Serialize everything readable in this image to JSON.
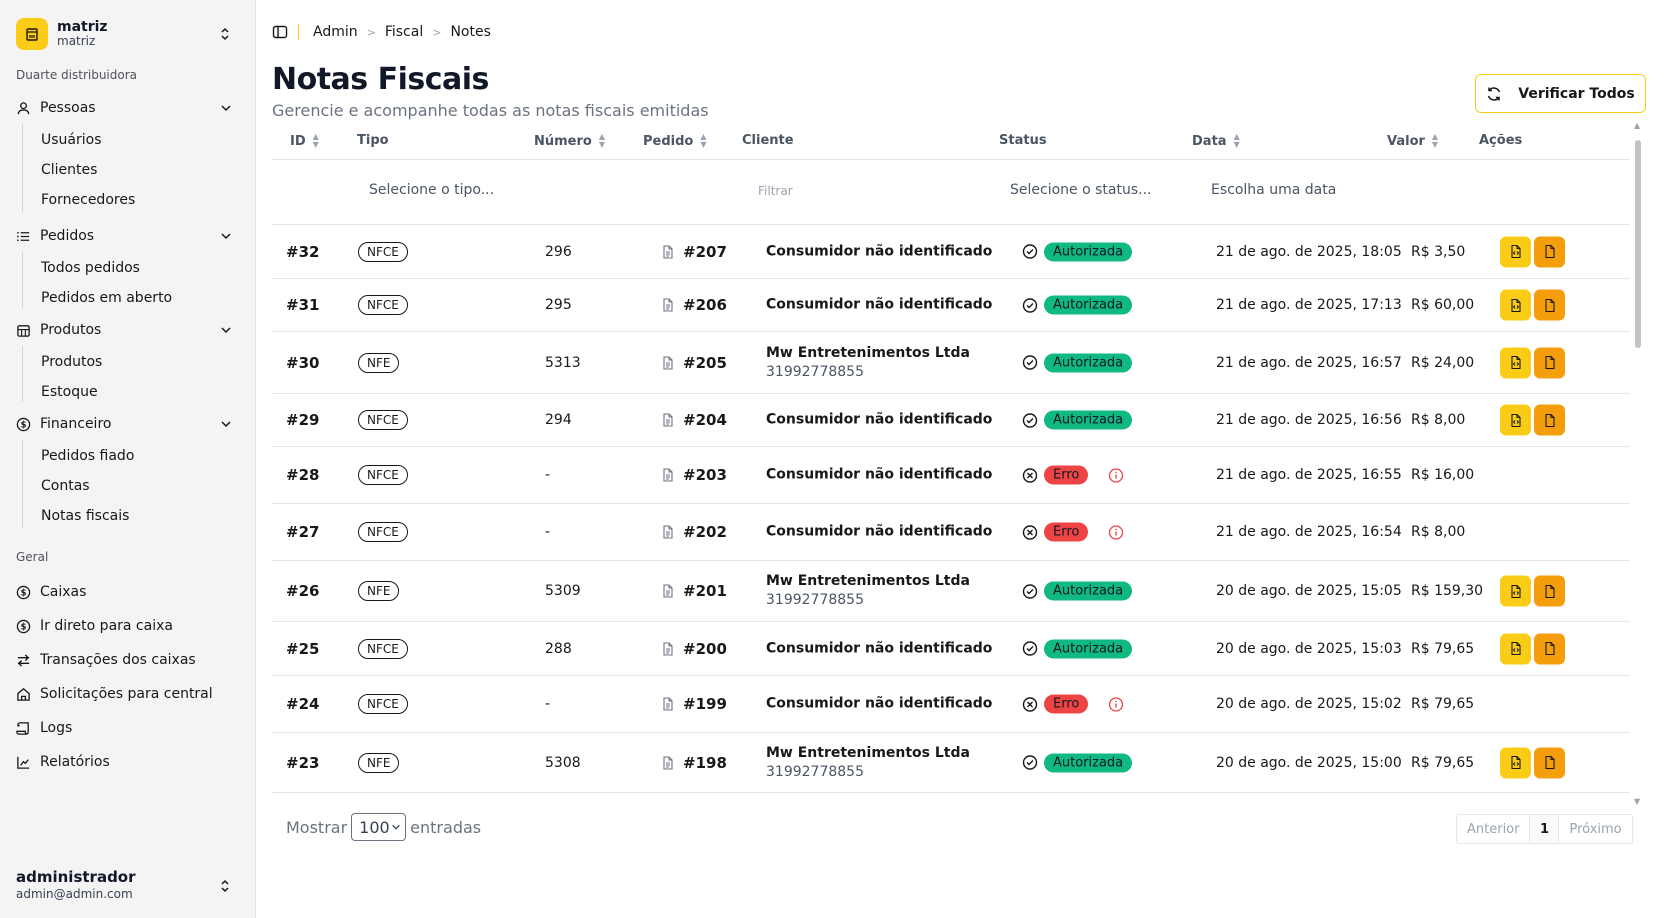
{
  "org": {
    "name": "matriz",
    "subtitle": "matriz"
  },
  "sidebar": {
    "group1_title": "Duarte distribuidora",
    "pessoas": {
      "label": "Pessoas",
      "items": [
        "Usuários",
        "Clientes",
        "Fornecedores"
      ]
    },
    "pedidos": {
      "label": "Pedidos",
      "items": [
        "Todos pedidos",
        "Pedidos em aberto"
      ]
    },
    "produtos": {
      "label": "Produtos",
      "items": [
        "Produtos",
        "Estoque"
      ]
    },
    "financeiro": {
      "label": "Financeiro",
      "items": [
        "Pedidos fiado",
        "Contas",
        "Notas fiscais"
      ]
    },
    "group2_title": "Geral",
    "geral": [
      "Caixas",
      "Ir direto para caixa",
      "Transações dos caixas",
      "Solicitações para central",
      "Logs",
      "Relatórios"
    ]
  },
  "user": {
    "name": "administrador",
    "email": "admin@admin.com"
  },
  "breadcrumb": [
    "Admin",
    "Fiscal",
    "Notes"
  ],
  "page": {
    "title": "Notas Fiscais",
    "subtitle": "Gerencie e acompanhe todas as notas fiscais emitidas",
    "verify_label": "Verificar Todos"
  },
  "table": {
    "headers": {
      "id": "ID",
      "tipo": "Tipo",
      "numero": "Número",
      "pedido": "Pedido",
      "cliente": "Cliente",
      "status": "Status",
      "data": "Data",
      "valor": "Valor",
      "acoes": "Ações"
    },
    "filters": {
      "tipo": "Selecione o tipo...",
      "cliente": "Filtrar",
      "status": "Selecione o status...",
      "data": "Escolha uma data"
    },
    "rows": [
      {
        "id": "#32",
        "tipo": "NFCE",
        "numero": "296",
        "pedido": "#207",
        "cliente": "Consumidor não identificado",
        "phone": "",
        "status": "Autorizada",
        "data": "21 de ago. de 2025, 18:05",
        "valor": "R$ 3,50"
      },
      {
        "id": "#31",
        "tipo": "NFCE",
        "numero": "295",
        "pedido": "#206",
        "cliente": "Consumidor não identificado",
        "phone": "",
        "status": "Autorizada",
        "data": "21 de ago. de 2025, 17:13",
        "valor": "R$ 60,00"
      },
      {
        "id": "#30",
        "tipo": "NFE",
        "numero": "5313",
        "pedido": "#205",
        "cliente": "Mw Entretenimentos Ltda",
        "phone": "31992778855",
        "status": "Autorizada",
        "data": "21 de ago. de 2025, 16:57",
        "valor": "R$ 24,00"
      },
      {
        "id": "#29",
        "tipo": "NFCE",
        "numero": "294",
        "pedido": "#204",
        "cliente": "Consumidor não identificado",
        "phone": "",
        "status": "Autorizada",
        "data": "21 de ago. de 2025, 16:56",
        "valor": "R$ 8,00"
      },
      {
        "id": "#28",
        "tipo": "NFCE",
        "numero": "-",
        "pedido": "#203",
        "cliente": "Consumidor não identificado",
        "phone": "",
        "status": "Erro",
        "data": "21 de ago. de 2025, 16:55",
        "valor": "R$ 16,00"
      },
      {
        "id": "#27",
        "tipo": "NFCE",
        "numero": "-",
        "pedido": "#202",
        "cliente": "Consumidor não identificado",
        "phone": "",
        "status": "Erro",
        "data": "21 de ago. de 2025, 16:54",
        "valor": "R$ 8,00"
      },
      {
        "id": "#26",
        "tipo": "NFE",
        "numero": "5309",
        "pedido": "#201",
        "cliente": "Mw Entretenimentos Ltda",
        "phone": "31992778855",
        "status": "Autorizada",
        "data": "20 de ago. de 2025, 15:05",
        "valor": "R$ 159,30"
      },
      {
        "id": "#25",
        "tipo": "NFCE",
        "numero": "288",
        "pedido": "#200",
        "cliente": "Consumidor não identificado",
        "phone": "",
        "status": "Autorizada",
        "data": "20 de ago. de 2025, 15:03",
        "valor": "R$ 79,65"
      },
      {
        "id": "#24",
        "tipo": "NFCE",
        "numero": "-",
        "pedido": "#199",
        "cliente": "Consumidor não identificado",
        "phone": "",
        "status": "Erro",
        "data": "20 de ago. de 2025, 15:02",
        "valor": "R$ 79,65"
      },
      {
        "id": "#23",
        "tipo": "NFE",
        "numero": "5308",
        "pedido": "#198",
        "cliente": "Mw Entretenimentos Ltda",
        "phone": "31992778855",
        "status": "Autorizada",
        "data": "20 de ago. de 2025, 15:00",
        "valor": "R$ 79,65"
      }
    ]
  },
  "footer": {
    "show_label": "Mostrar",
    "page_size": "100",
    "entries_label": "entradas",
    "prev": "Anterior",
    "current_page": "1",
    "next": "Próximo"
  },
  "colors": {
    "accent": "#facc15",
    "accent_dark": "#f59e0b",
    "success": "#10b981",
    "error": "#ef4444"
  }
}
